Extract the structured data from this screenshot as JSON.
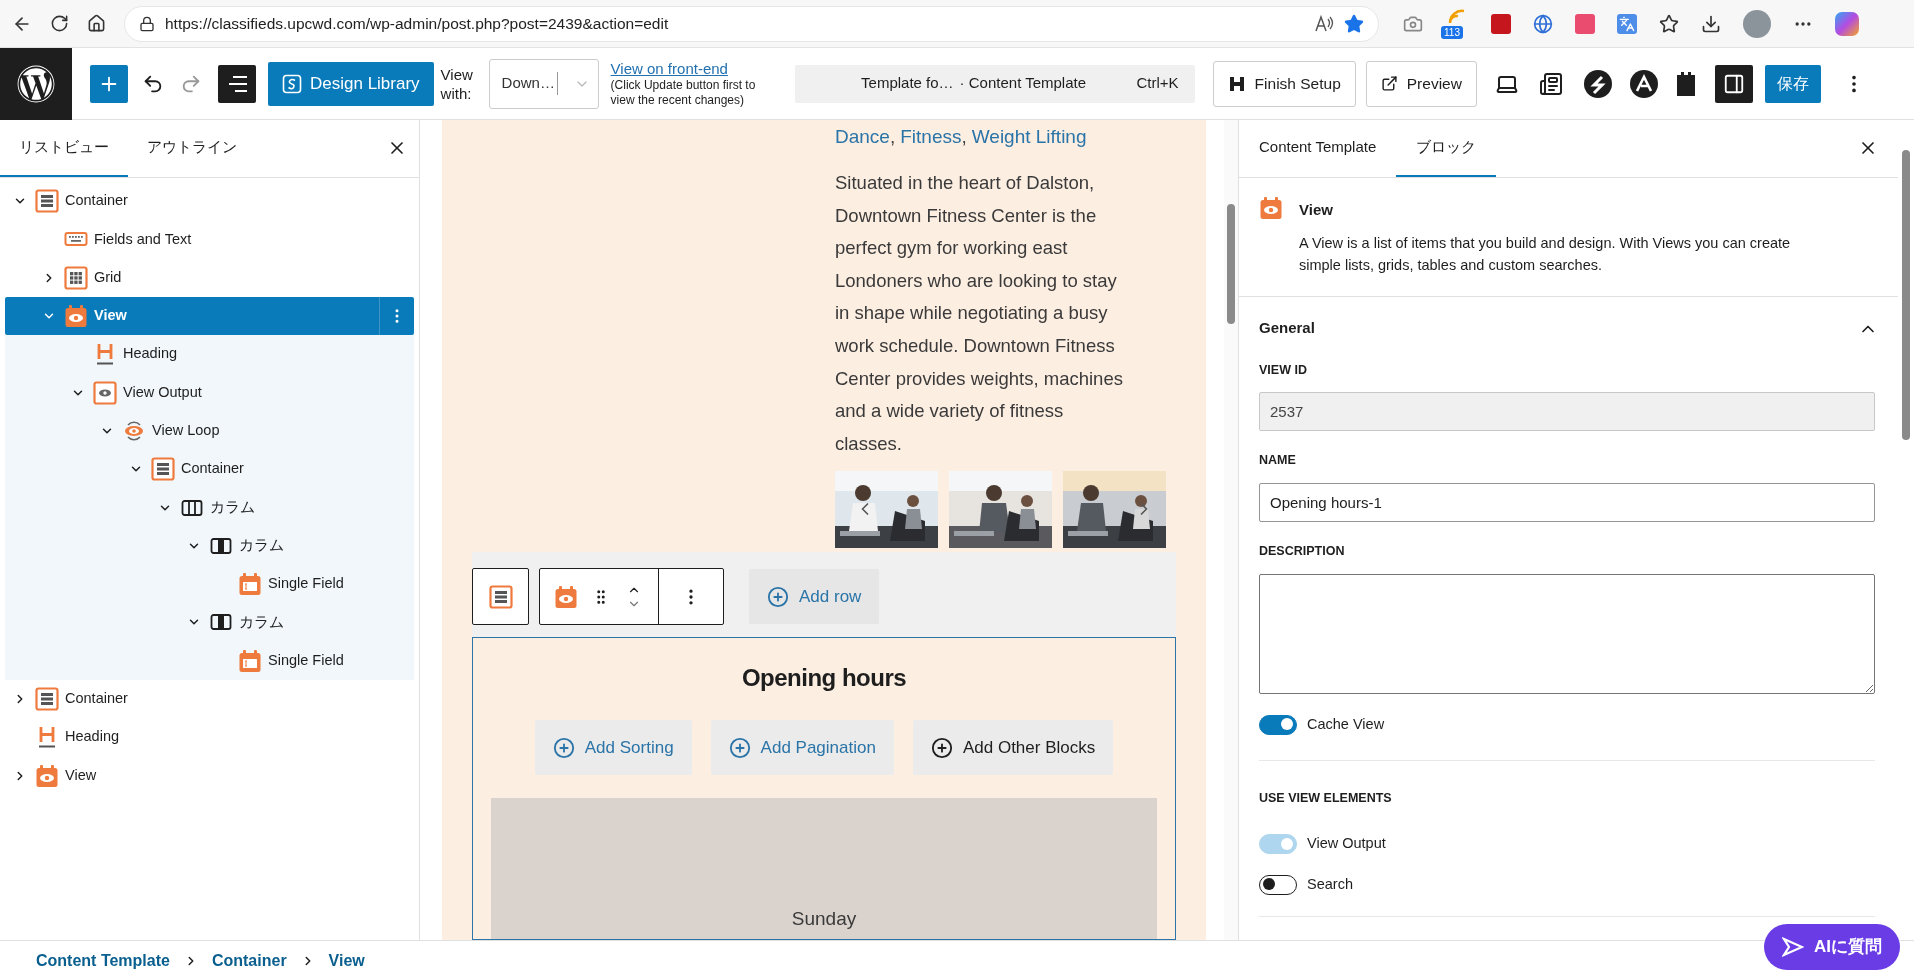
{
  "browser": {
    "url": "https://classifieds.upcwd.com/wp-admin/post.php?post=2439&action=edit",
    "extension_badge": "113"
  },
  "toolbar": {
    "design_library": "Design Library",
    "view_with_label": "View with:",
    "view_with_value": "Down…",
    "front_end_link": "View on front-end",
    "front_end_note": "(Click Update button first to view the recent changes)",
    "command_title": "Template fo…",
    "command_subtitle": "· Content Template",
    "command_shortcut": "Ctrl+K",
    "finish_setup": "Finish Setup",
    "preview": "Preview",
    "save": "保存"
  },
  "left_panel": {
    "tabs": [
      {
        "label": "リストビュー",
        "selected": true
      },
      {
        "label": "アウトライン",
        "selected": false
      }
    ],
    "tree": [
      {
        "kind": "container",
        "label": "Container",
        "expanded": true,
        "selected": false,
        "children": [
          {
            "kind": "fields",
            "label": "Fields and Text",
            "selected": false
          },
          {
            "kind": "grid",
            "label": "Grid",
            "expanded": false,
            "selected": false
          },
          {
            "kind": "view",
            "label": "View",
            "expanded": true,
            "selected": true,
            "children": [
              {
                "kind": "heading",
                "label": "Heading",
                "selected": false
              },
              {
                "kind": "view-output",
                "label": "View Output",
                "expanded": true,
                "selected": false,
                "children": [
                  {
                    "kind": "view-loop",
                    "label": "View Loop",
                    "expanded": true,
                    "selected": false,
                    "children": [
                      {
                        "kind": "container",
                        "label": "Container",
                        "expanded": true,
                        "selected": false,
                        "children": [
                          {
                            "kind": "columns",
                            "label": "カラム",
                            "expanded": true,
                            "selected": false,
                            "children": [
                              {
                                "kind": "column",
                                "label": "カラム",
                                "expanded": true,
                                "selected": false,
                                "children": [
                                  {
                                    "kind": "single-field",
                                    "label": "Single Field",
                                    "selected": false
                                  }
                                ]
                              },
                              {
                                "kind": "column",
                                "label": "カラム",
                                "expanded": true,
                                "selected": false,
                                "children": [
                                  {
                                    "kind": "single-field",
                                    "label": "Single Field",
                                    "selected": false
                                  }
                                ]
                              }
                            ]
                          }
                        ]
                      }
                    ]
                  }
                ]
              }
            ]
          }
        ]
      },
      {
        "kind": "container",
        "label": "Container",
        "expanded": false,
        "selected": false
      },
      {
        "kind": "heading",
        "label": "Heading",
        "selected": false
      },
      {
        "kind": "view",
        "label": "View",
        "expanded": false,
        "selected": false
      }
    ]
  },
  "canvas": {
    "tags": [
      "Dance",
      "Fitness",
      "Weight Lifting"
    ],
    "tag_separator": ",",
    "description": "Situated in the heart of Dalston, Downtown Fitness Center is the perfect gym for working east Londoners who are looking to stay in shape while negotiating a busy work schedule. Downtown Fitness Center provides weights, machines and a wide variety of fitness classes.",
    "photos": [
      {
        "kind": "picture"
      },
      {
        "kind": "picture"
      },
      {
        "kind": "picture"
      }
    ],
    "add_row": "Add row",
    "view_title": "Opening hours",
    "view_buttons": [
      {
        "label": "Add Sorting",
        "kind": "accent"
      },
      {
        "label": "Add Pagination",
        "kind": "accent"
      },
      {
        "label": "Add Other Blocks",
        "kind": "plain"
      }
    ],
    "day": "Sunday"
  },
  "right_panel": {
    "tabs": [
      {
        "label": "Content Template",
        "selected": false
      },
      {
        "label": "ブロック",
        "selected": true
      }
    ],
    "block_title": "View",
    "block_description": "A View is a list of items that you build and design. With Views you can create simple lists, grids, tables and custom searches.",
    "section": {
      "title": "General",
      "expanded": true
    },
    "fields": [
      {
        "label": "VIEW ID",
        "kind": "input",
        "value": "2537",
        "disabled": true
      },
      {
        "label": "NAME",
        "kind": "input",
        "value": "Opening hours-1",
        "disabled": false
      },
      {
        "label": "DESCRIPTION",
        "kind": "textarea",
        "disabled": false
      }
    ],
    "cache_toggle": {
      "label": "Cache View",
      "on": true
    },
    "elements_title": "USE VIEW ELEMENTS",
    "element_toggles": [
      {
        "label": "View Output",
        "on": true,
        "disabled": true
      },
      {
        "label": "Search",
        "on": false
      }
    ],
    "ai_button": "AIに質問"
  },
  "breadcrumb": [
    "Content Template",
    "Container",
    "View"
  ]
}
